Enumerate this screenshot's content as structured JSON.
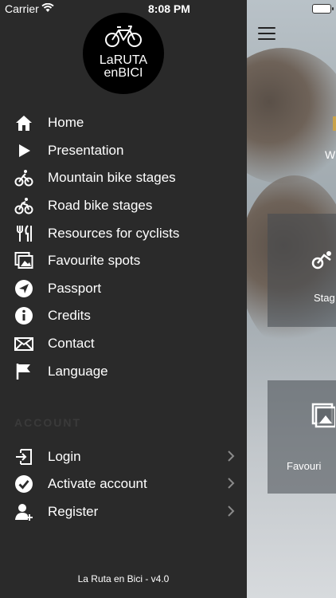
{
  "status_bar": {
    "carrier": "Carrier",
    "time": "8:08 PM"
  },
  "logo": {
    "line1": "LaRUTA",
    "line2": "enBICI"
  },
  "menu": {
    "items": [
      {
        "label": "Home",
        "icon": "home-icon"
      },
      {
        "label": "Presentation",
        "icon": "play-icon"
      },
      {
        "label": "Mountain bike stages",
        "icon": "mountain-bike-icon"
      },
      {
        "label": "Road bike stages",
        "icon": "road-bike-icon"
      },
      {
        "label": "Resources for cyclists",
        "icon": "cutlery-icon"
      },
      {
        "label": "Favourite spots",
        "icon": "photos-icon"
      },
      {
        "label": "Passport",
        "icon": "location-arrow-icon"
      },
      {
        "label": "Credits",
        "icon": "info-icon"
      },
      {
        "label": "Contact",
        "icon": "envelope-icon"
      },
      {
        "label": "Language",
        "icon": "flag-icon"
      }
    ]
  },
  "account": {
    "section_title": "ACCOUNT",
    "items": [
      {
        "label": "Login",
        "icon": "login-icon"
      },
      {
        "label": "Activate account",
        "icon": "check-circle-icon"
      },
      {
        "label": "Register",
        "icon": "add-user-icon"
      }
    ]
  },
  "footer": {
    "version": "La Ruta en Bici - v4.0"
  },
  "background": {
    "subtitle_fragment": "W",
    "card1_label": "Stag",
    "card2_label": "Favouri"
  },
  "colors": {
    "drawer_bg": "#2a2a2a",
    "text": "#ffffff",
    "chevron": "#8a8a8a"
  }
}
